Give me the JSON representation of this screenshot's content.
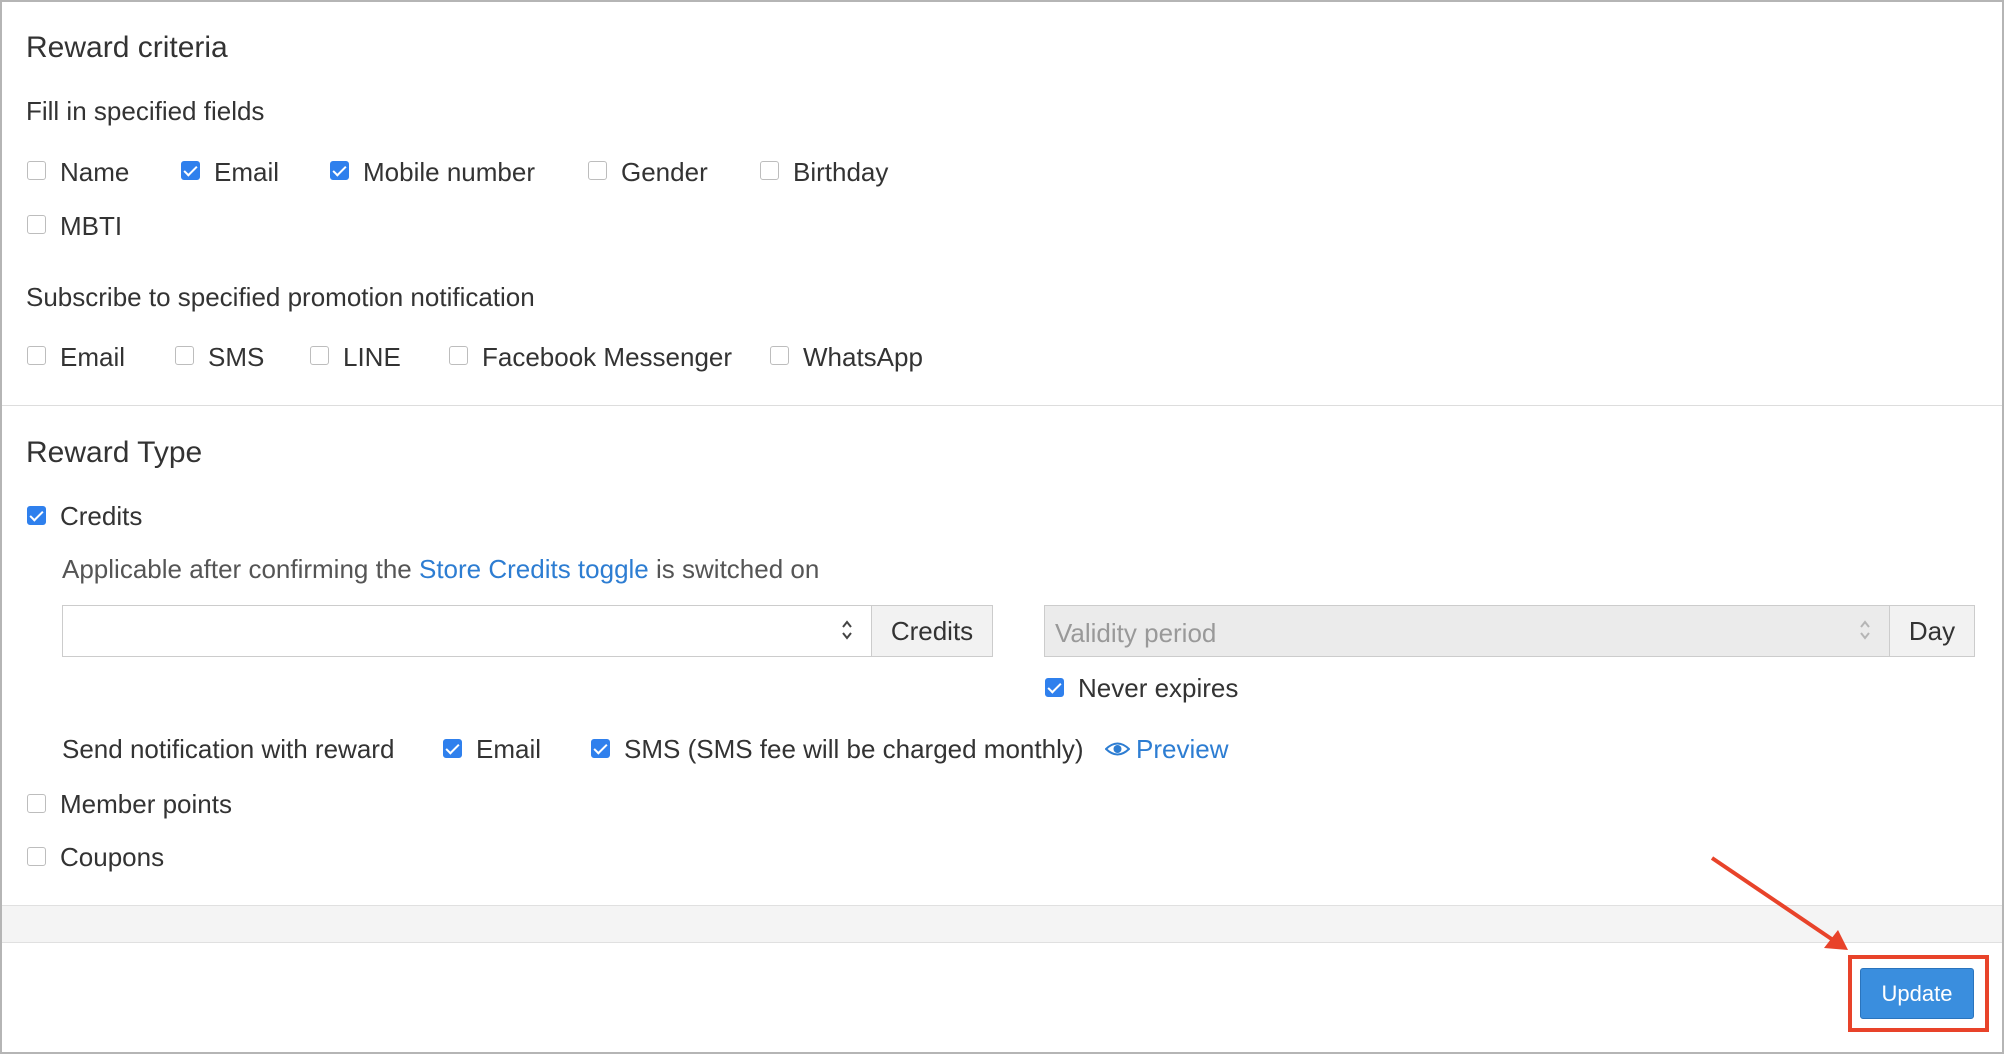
{
  "reward_criteria": {
    "title": "Reward criteria",
    "fill_fields_label": "Fill in specified fields",
    "fields": [
      {
        "label": "Name",
        "checked": false
      },
      {
        "label": "Email",
        "checked": true
      },
      {
        "label": "Mobile number",
        "checked": true
      },
      {
        "label": "Gender",
        "checked": false
      },
      {
        "label": "Birthday",
        "checked": false
      },
      {
        "label": "MBTI",
        "checked": false
      }
    ],
    "subscribe_label": "Subscribe to specified promotion notification",
    "channels": [
      {
        "label": "Email",
        "checked": false
      },
      {
        "label": "SMS",
        "checked": false
      },
      {
        "label": "LINE",
        "checked": false
      },
      {
        "label": "Facebook Messenger",
        "checked": false
      },
      {
        "label": "WhatsApp",
        "checked": false
      }
    ]
  },
  "reward_type": {
    "title": "Reward Type",
    "credits": {
      "label": "Credits",
      "checked": true
    },
    "applicable_prefix": "Applicable after confirming the",
    "applicable_link": "Store Credits toggle",
    "applicable_suffix": "is switched on",
    "credits_value": "",
    "credits_addon": "Credits",
    "validity_placeholder": "Validity period",
    "validity_addon": "Day",
    "never_expires": {
      "label": "Never expires",
      "checked": true
    },
    "send_notification_label": "Send notification with reward",
    "notify_email": {
      "label": "Email",
      "checked": true
    },
    "notify_sms": {
      "label": "SMS (SMS fee will be charged monthly)",
      "checked": true
    },
    "preview_label": "Preview",
    "member_points": {
      "label": "Member points",
      "checked": false
    },
    "coupons": {
      "label": "Coupons",
      "checked": false
    }
  },
  "footer": {
    "update_label": "Update"
  },
  "icons": {
    "preview": "eye-icon",
    "spinner": "spinner-arrows-icon",
    "annotation": "red-arrow-icon"
  },
  "colors": {
    "accent": "#2f80ed",
    "link": "#2d7dd2",
    "button": "#3a8ede",
    "highlight": "#e8432a"
  }
}
